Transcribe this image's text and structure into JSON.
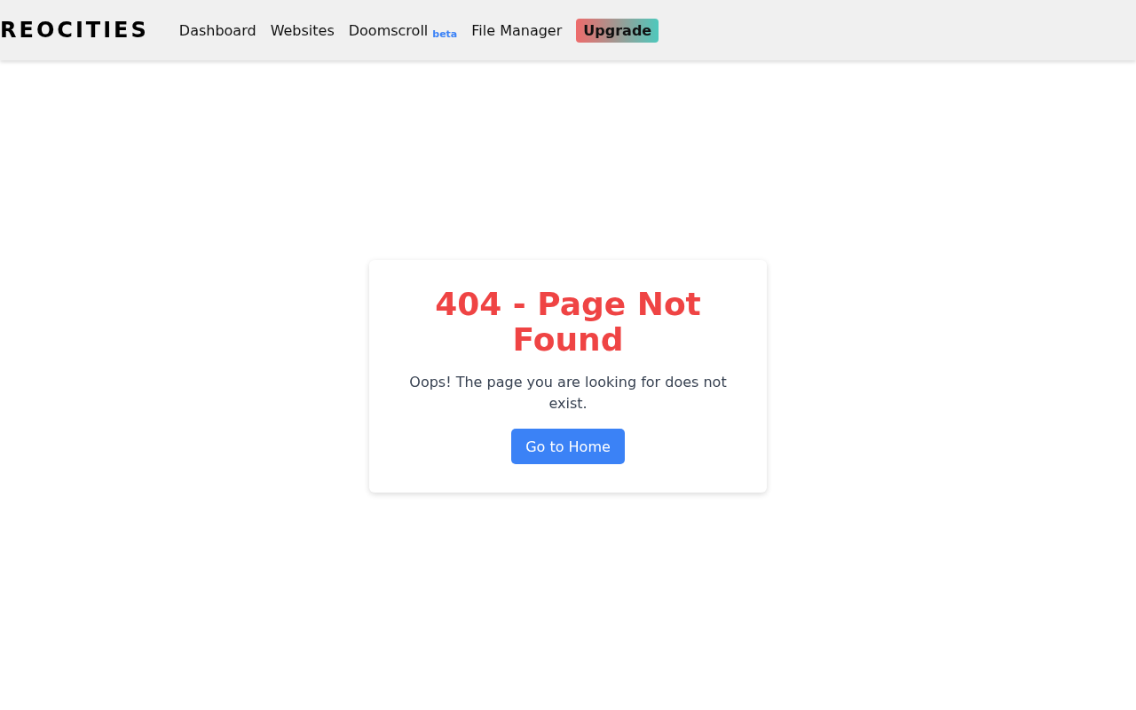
{
  "header": {
    "logo": "REOCITIES",
    "nav": [
      {
        "kind": "link",
        "label": "Dashboard"
      },
      {
        "kind": "link",
        "label": "Websites"
      },
      {
        "kind": "link",
        "label": "Doomscroll",
        "badge": "beta"
      },
      {
        "kind": "link",
        "label": "File Manager"
      },
      {
        "kind": "upgrade",
        "label": "Upgrade"
      }
    ]
  },
  "card": {
    "title": "404 - Page Not Found",
    "message": "Oops! The page you are looking for does not exist.",
    "button": "Go to Home"
  }
}
